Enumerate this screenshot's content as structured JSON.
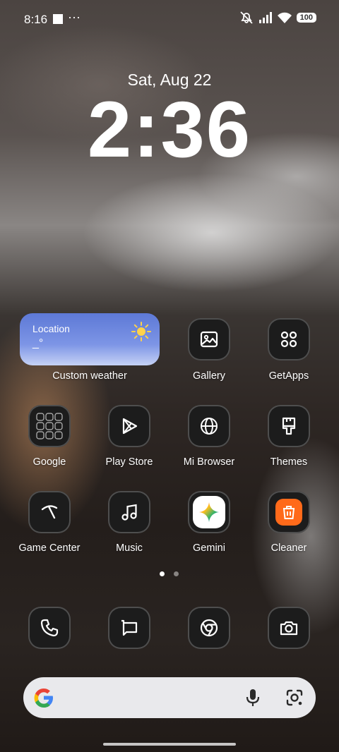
{
  "status_bar": {
    "time": "8:16",
    "more": "···",
    "battery": "100"
  },
  "lock": {
    "date": "Sat, Aug 22",
    "clock": "2:36"
  },
  "weather_widget": {
    "location": "Location",
    "temp": "_°",
    "label": "Custom weather"
  },
  "apps": {
    "gallery": "Gallery",
    "getapps": "GetApps",
    "google": "Google",
    "play_store": "Play Store",
    "mi_browser": "Mi Browser",
    "themes": "Themes",
    "game_center": "Game Center",
    "music": "Music",
    "gemini": "Gemini",
    "cleaner": "Cleaner"
  },
  "pages": {
    "count": 2,
    "active": 0
  },
  "dock": [
    "phone-icon",
    "messages-icon",
    "chrome-icon",
    "camera-icon"
  ],
  "colors": {
    "cleaner_orange": "#ff6a1a",
    "weather_blue": "#5d79d6"
  }
}
